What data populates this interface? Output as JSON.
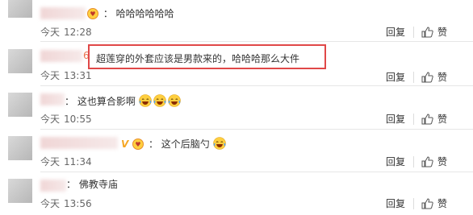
{
  "comments": [
    {
      "text": "哈哈哈哈哈哈",
      "colon": "：",
      "time_date": "今天",
      "time_clock": "12:28",
      "reply_label": "回复",
      "like_label": "赞",
      "has_vip_badge": false,
      "has_badge": true
    },
    {
      "name_suffix": "6",
      "text": "超莲穿的外套应该是男款来的，哈哈哈那么大件",
      "colon": "：",
      "time_date": "今天",
      "time_clock": "13:31",
      "reply_label": "回复",
      "like_label": "赞",
      "highlighted": true
    },
    {
      "text": "这也算合影啊",
      "colon": "：",
      "time_date": "今天",
      "time_clock": "10:55",
      "reply_label": "回复",
      "like_label": "赞",
      "emoji_count": 3,
      "emoji": "laughing-with-tears"
    },
    {
      "text": "这个后脑勺",
      "colon": "：",
      "time_date": "今天",
      "time_clock": "11:34",
      "reply_label": "回复",
      "like_label": "赞",
      "vip_label": "V",
      "has_badge": true,
      "emoji": "laughing-with-tears"
    },
    {
      "text": "佛教寺庙",
      "colon": "：",
      "time_date": "今天",
      "time_clock": "13:56",
      "reply_label": "回复",
      "like_label": "赞"
    }
  ],
  "colors": {
    "highlight_border": "#e04848",
    "link_name": "#eb7350",
    "vip": "#f5a623",
    "emoji_face": "#ffcf3f"
  }
}
